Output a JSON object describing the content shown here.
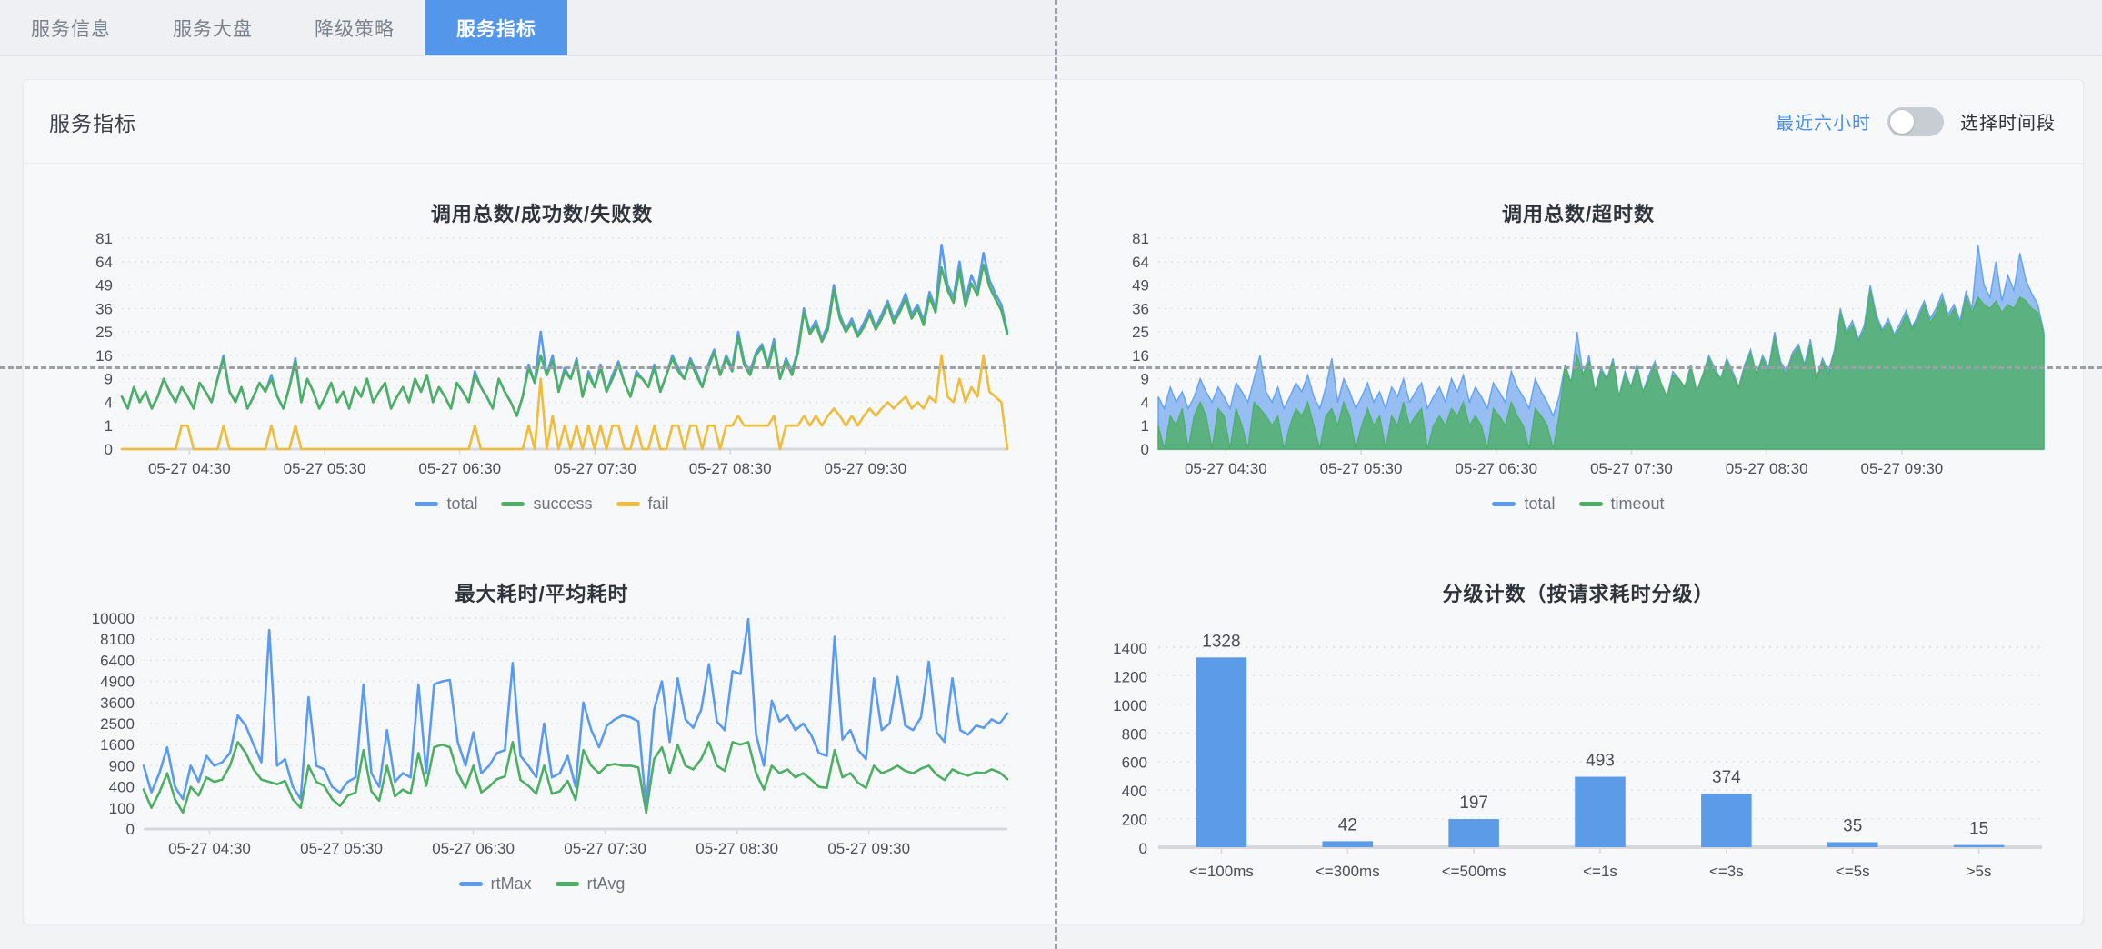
{
  "tabs": [
    {
      "label": "服务信息",
      "active": false
    },
    {
      "label": "服务大盘",
      "active": false
    },
    {
      "label": "降级策略",
      "active": false
    },
    {
      "label": "服务指标",
      "active": true
    }
  ],
  "card": {
    "title": "服务指标",
    "range_active_label": "最近六小时",
    "range_picker_label": "选择时间段",
    "switch_on": false
  },
  "colors": {
    "blue": "#5B9BEF",
    "green": "#4CAF63",
    "yellow": "#EFBC3B",
    "tab_active": "#5496ea",
    "bar": "#5B9BE8",
    "area_blue": "#6FA8F2",
    "area_green": "#47A86B"
  },
  "chart_data": [
    {
      "id": "calls-total-success-fail",
      "type": "line",
      "title": "调用总数/成功数/失败数",
      "xlabel": "",
      "ylabel": "",
      "grid": true,
      "legend_position": "bottom",
      "ytick_labels": [
        0,
        1,
        4,
        9,
        16,
        25,
        36,
        49,
        64,
        81
      ],
      "ylim": [
        0,
        81
      ],
      "yscale": "sqrt",
      "xtick_labels": [
        "05-27 04:30",
        "05-27 05:30",
        "05-27 06:30",
        "05-27 07:30",
        "05-27 08:30",
        "05-27 09:30"
      ],
      "series": [
        {
          "name": "total",
          "color": "#5B9BEF",
          "values": [
            5,
            3,
            7,
            4,
            6,
            3,
            5,
            9,
            6,
            4,
            7,
            5,
            3,
            8,
            6,
            4,
            9,
            16,
            6,
            4,
            7,
            3,
            5,
            8,
            6,
            10,
            5,
            3,
            7,
            15,
            4,
            9,
            6,
            3,
            5,
            8,
            4,
            6,
            3,
            7,
            5,
            9,
            4,
            6,
            8,
            3,
            5,
            7,
            4,
            9,
            6,
            10,
            4,
            7,
            5,
            3,
            8,
            6,
            4,
            11,
            7,
            5,
            3,
            9,
            6,
            4,
            2,
            5,
            13,
            8,
            25,
            10,
            16,
            6,
            12,
            9,
            15,
            5,
            11,
            7,
            13,
            6,
            10,
            14,
            8,
            5,
            11,
            9,
            7,
            13,
            6,
            10,
            16,
            12,
            9,
            15,
            11,
            7,
            13,
            18,
            10,
            16,
            12,
            25,
            14,
            11,
            17,
            20,
            13,
            22,
            9,
            15,
            11,
            18,
            36,
            25,
            30,
            22,
            28,
            49,
            33,
            26,
            31,
            24,
            29,
            35,
            27,
            33,
            40,
            31,
            36,
            44,
            33,
            38,
            30,
            45,
            36,
            76,
            49,
            42,
            64,
            40,
            55,
            46,
            70,
            52,
            44,
            38,
            25
          ]
        },
        {
          "name": "success",
          "color": "#4CAF63",
          "values": [
            5,
            3,
            7,
            4,
            6,
            3,
            5,
            9,
            6,
            4,
            7,
            5,
            3,
            8,
            6,
            4,
            9,
            15,
            6,
            4,
            7,
            3,
            5,
            8,
            6,
            9,
            5,
            3,
            7,
            14,
            4,
            9,
            6,
            3,
            5,
            8,
            4,
            6,
            3,
            7,
            5,
            9,
            4,
            6,
            8,
            3,
            5,
            7,
            4,
            9,
            6,
            10,
            4,
            7,
            5,
            3,
            8,
            6,
            4,
            10,
            7,
            5,
            3,
            9,
            6,
            4,
            2,
            5,
            12,
            8,
            16,
            10,
            14,
            6,
            11,
            9,
            14,
            5,
            10,
            7,
            12,
            6,
            9,
            13,
            8,
            5,
            10,
            9,
            7,
            12,
            6,
            10,
            15,
            11,
            9,
            14,
            10,
            7,
            12,
            17,
            10,
            15,
            11,
            23,
            13,
            10,
            16,
            19,
            12,
            20,
            9,
            14,
            10,
            17,
            34,
            24,
            28,
            21,
            26,
            46,
            31,
            25,
            29,
            23,
            27,
            33,
            26,
            31,
            38,
            29,
            34,
            41,
            31,
            36,
            28,
            42,
            34,
            60,
            46,
            39,
            58,
            37,
            50,
            43,
            62,
            48,
            41,
            35,
            24
          ]
        },
        {
          "name": "fail",
          "color": "#EFBC3B",
          "values": [
            0,
            0,
            0,
            0,
            0,
            0,
            0,
            0,
            0,
            0,
            1,
            1,
            0,
            0,
            0,
            0,
            0,
            1,
            0,
            0,
            0,
            0,
            0,
            0,
            0,
            1,
            0,
            0,
            0,
            1,
            0,
            0,
            0,
            0,
            0,
            0,
            0,
            0,
            0,
            0,
            0,
            0,
            0,
            0,
            0,
            0,
            0,
            0,
            0,
            0,
            0,
            0,
            0,
            0,
            0,
            0,
            0,
            0,
            0,
            1,
            0,
            0,
            0,
            0,
            0,
            0,
            0,
            0,
            1,
            0,
            9,
            0,
            2,
            0,
            1,
            0,
            1,
            0,
            1,
            0,
            1,
            0,
            1,
            1,
            0,
            0,
            1,
            0,
            0,
            1,
            0,
            0,
            1,
            1,
            0,
            1,
            1,
            0,
            1,
            1,
            0,
            1,
            1,
            2,
            1,
            1,
            1,
            1,
            1,
            2,
            0,
            1,
            1,
            1,
            2,
            1,
            2,
            1,
            2,
            3,
            2,
            1,
            2,
            1,
            2,
            3,
            2,
            3,
            4,
            3,
            4,
            5,
            3,
            4,
            3,
            5,
            4,
            16,
            5,
            4,
            9,
            4,
            7,
            5,
            16,
            6,
            5,
            4,
            0
          ]
        }
      ]
    },
    {
      "id": "calls-total-timeout",
      "type": "area",
      "title": "调用总数/超时数",
      "xlabel": "",
      "ylabel": "",
      "grid": true,
      "legend_position": "bottom",
      "ytick_labels": [
        0,
        1,
        4,
        9,
        16,
        25,
        36,
        49,
        64,
        81
      ],
      "ylim": [
        0,
        81
      ],
      "yscale": "sqrt",
      "xtick_labels": [
        "05-27 04:30",
        "05-27 05:30",
        "05-27 06:30",
        "05-27 07:30",
        "05-27 08:30",
        "05-27 09:30"
      ],
      "series": [
        {
          "name": "total",
          "color": "#5B9BEF",
          "values": [
            5,
            3,
            7,
            4,
            6,
            3,
            5,
            9,
            6,
            4,
            7,
            5,
            3,
            8,
            6,
            4,
            9,
            16,
            6,
            4,
            7,
            3,
            5,
            8,
            6,
            10,
            5,
            3,
            7,
            15,
            4,
            9,
            6,
            3,
            5,
            8,
            4,
            6,
            3,
            7,
            5,
            9,
            4,
            6,
            8,
            3,
            5,
            7,
            4,
            9,
            6,
            10,
            4,
            7,
            5,
            3,
            8,
            6,
            4,
            11,
            7,
            5,
            3,
            9,
            6,
            4,
            2,
            5,
            13,
            8,
            25,
            10,
            16,
            6,
            12,
            9,
            15,
            5,
            11,
            7,
            13,
            6,
            10,
            14,
            8,
            5,
            11,
            9,
            7,
            13,
            6,
            10,
            16,
            12,
            9,
            15,
            11,
            7,
            13,
            18,
            10,
            16,
            12,
            25,
            14,
            11,
            17,
            20,
            13,
            22,
            9,
            15,
            11,
            18,
            36,
            25,
            30,
            22,
            28,
            49,
            33,
            26,
            31,
            24,
            29,
            35,
            27,
            33,
            40,
            31,
            36,
            44,
            33,
            38,
            30,
            45,
            36,
            76,
            49,
            42,
            64,
            40,
            55,
            46,
            70,
            52,
            44,
            38,
            25
          ]
        },
        {
          "name": "timeout",
          "color": "#4CAF63",
          "values": [
            1,
            0,
            2,
            1,
            3,
            0,
            2,
            4,
            2,
            0,
            3,
            2,
            0,
            3,
            1,
            0,
            4,
            3,
            2,
            1,
            2,
            0,
            1,
            3,
            2,
            4,
            1,
            0,
            2,
            3,
            1,
            4,
            2,
            0,
            1,
            3,
            1,
            2,
            0,
            2,
            1,
            4,
            1,
            2,
            3,
            0,
            1,
            2,
            1,
            3,
            2,
            4,
            1,
            2,
            1,
            0,
            3,
            2,
            1,
            4,
            2,
            1,
            0,
            3,
            2,
            1,
            0,
            2,
            13,
            8,
            16,
            10,
            14,
            6,
            11,
            9,
            14,
            5,
            10,
            7,
            12,
            6,
            9,
            13,
            8,
            5,
            10,
            9,
            7,
            12,
            6,
            10,
            15,
            11,
            9,
            14,
            10,
            7,
            12,
            17,
            10,
            15,
            11,
            23,
            13,
            10,
            16,
            19,
            12,
            20,
            9,
            14,
            10,
            17,
            34,
            24,
            28,
            21,
            26,
            46,
            31,
            25,
            29,
            23,
            27,
            33,
            26,
            31,
            38,
            29,
            34,
            41,
            31,
            36,
            28,
            42,
            34,
            42,
            38,
            36,
            40,
            34,
            38,
            36,
            42,
            40,
            36,
            34,
            24
          ]
        }
      ]
    },
    {
      "id": "rt-max-avg",
      "type": "line",
      "title": "最大耗时/平均耗时",
      "xlabel": "",
      "ylabel": "",
      "grid": true,
      "legend_position": "bottom",
      "ytick_labels": [
        0,
        100,
        400,
        900,
        1600,
        2500,
        3600,
        4900,
        6400,
        8100,
        10000
      ],
      "ylim": [
        0,
        10000
      ],
      "yscale": "sqrt",
      "xtick_labels": [
        "05-27 04:30",
        "05-27 05:30",
        "05-27 06:30",
        "05-27 07:30",
        "05-27 08:30",
        "05-27 09:30"
      ],
      "series": [
        {
          "name": "rtMax",
          "color": "#5B9BEF",
          "values": [
            900,
            300,
            700,
            1500,
            400,
            200,
            900,
            500,
            1200,
            900,
            1000,
            1300,
            2900,
            2400,
            1600,
            1000,
            8900,
            900,
            1100,
            400,
            200,
            3900,
            900,
            800,
            400,
            300,
            500,
            600,
            4700,
            700,
            400,
            2200,
            500,
            700,
            600,
            4700,
            700,
            4700,
            4900,
            5000,
            1700,
            900,
            2100,
            700,
            900,
            1300,
            1400,
            6200,
            1200,
            900,
            600,
            2500,
            600,
            700,
            1200,
            400,
            3600,
            2200,
            1500,
            2400,
            2700,
            2900,
            2800,
            2600,
            100,
            3200,
            4900,
            1700,
            5100,
            2700,
            2300,
            3200,
            6100,
            2600,
            2200,
            5600,
            5400,
            9900,
            2000,
            900,
            3700,
            2600,
            2900,
            2200,
            2500,
            2000,
            1300,
            1200,
            8300,
            1800,
            2200,
            1400,
            1100,
            5100,
            2200,
            2500,
            5200,
            2400,
            2200,
            2800,
            6300,
            2100,
            1700,
            5100,
            2200,
            2000,
            2400,
            2300,
            2700,
            2500,
            3000
          ]
        },
        {
          "name": "rtAvg",
          "color": "#4CAF63",
          "values": [
            350,
            100,
            300,
            700,
            200,
            60,
            400,
            250,
            600,
            500,
            550,
            900,
            1700,
            1300,
            800,
            550,
            500,
            450,
            520,
            200,
            100,
            900,
            500,
            420,
            200,
            120,
            250,
            300,
            1400,
            320,
            180,
            900,
            240,
            350,
            280,
            1300,
            420,
            1500,
            1600,
            1500,
            700,
            380,
            900,
            300,
            400,
            560,
            620,
            1700,
            540,
            420,
            280,
            900,
            280,
            320,
            520,
            190,
            1400,
            900,
            700,
            900,
            950,
            900,
            900,
            850,
            60,
            1100,
            1500,
            700,
            1600,
            900,
            800,
            1100,
            1700,
            900,
            760,
            1700,
            1600,
            1700,
            700,
            350,
            900,
            700,
            800,
            600,
            700,
            550,
            400,
            380,
            1400,
            600,
            700,
            480,
            380,
            900,
            700,
            780,
            900,
            760,
            700,
            820,
            900,
            660,
            540,
            800,
            700,
            640,
            720,
            700,
            800,
            720,
            560
          ]
        }
      ]
    },
    {
      "id": "grade-count",
      "type": "bar",
      "title": "分级计数（按请求耗时分级）",
      "xlabel": "",
      "ylabel": "",
      "grid": true,
      "legend_position": "none",
      "categories": [
        "<=100ms",
        "<=300ms",
        "<=500ms",
        "<=1s",
        "<=3s",
        "<=5s",
        ">5s"
      ],
      "values": [
        1328,
        42,
        197,
        493,
        374,
        35,
        15
      ],
      "ytick_labels": [
        0,
        200,
        400,
        600,
        800,
        1000,
        1200,
        1400
      ],
      "ylim": [
        0,
        1400
      ]
    }
  ]
}
